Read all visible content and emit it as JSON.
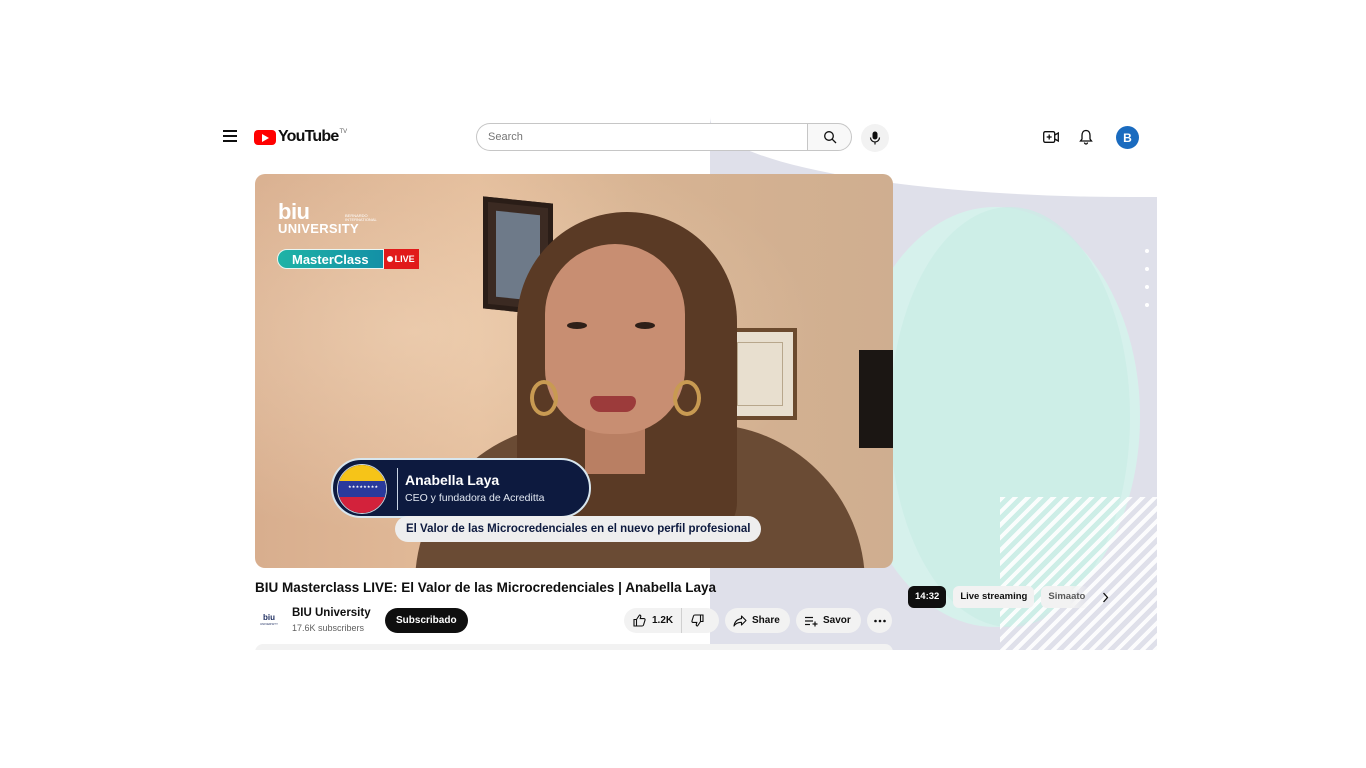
{
  "header": {
    "logo_text": "YouTube",
    "logo_badge": "TV",
    "search_placeholder": "Search",
    "avatar_letter": "B"
  },
  "video": {
    "overlay": {
      "brand_line1": "biu",
      "brand_line2": "UNIVERSITY",
      "brand_small": "BERNARDO INTERNATIONAL",
      "masterclass_label": "MasterClass",
      "live_label": "LIVE",
      "speaker_name": "Anabella Laya",
      "speaker_role": "CEO y fundadora de Acreditta",
      "topic": "El Valor de las Microcredenciales en el nuevo perfil profesional",
      "flag_stars": "★★★★★★★★"
    },
    "title": "BIU Masterclass LIVE: El Valor de las Microcredenciales | Anabella Laya"
  },
  "channel": {
    "logo_text": "biu",
    "logo_small": "UNIVERSITY",
    "name": "BIU University",
    "subscribers": "17.6K subscribers",
    "subscribe_label": "Subscribado"
  },
  "actions": {
    "like_count": "1.2K",
    "share_label": "Share",
    "save_label": "Savor"
  },
  "chips": {
    "items": [
      "14:32",
      "Live streaming",
      "Simaato"
    ]
  },
  "colors": {
    "youtube_red": "#ff0000",
    "avatar_blue": "#1a6bbf",
    "live_red": "#e11a1a",
    "masterclass_teal": "#1fb3a6",
    "lower_third_navy": "#0d1a3f"
  },
  "icons": [
    "menu-icon",
    "search-icon",
    "mic-icon",
    "create-icon",
    "bell-icon",
    "thumbs-up-icon",
    "thumbs-down-icon",
    "share-icon",
    "save-icon",
    "more-icon",
    "chevron-right-icon"
  ]
}
